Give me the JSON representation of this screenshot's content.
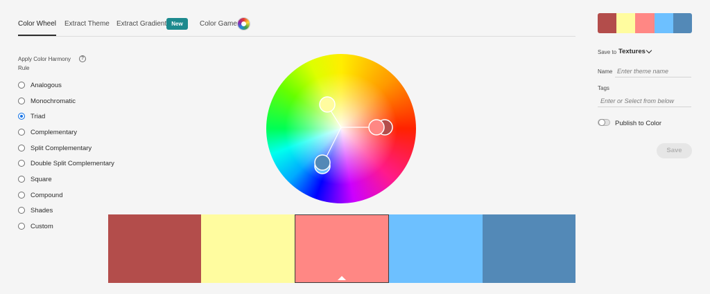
{
  "tabs": {
    "color_wheel": "Color Wheel",
    "extract_theme": "Extract Theme",
    "extract_gradient": "Extract Gradient",
    "new_badge": "New",
    "color_game": "Color Game"
  },
  "harmony": {
    "title": "Apply Color Harmony Rule",
    "selected": "Triad",
    "rules": [
      "Analogous",
      "Monochromatic",
      "Triad",
      "Complementary",
      "Split Complementary",
      "Double Split Complementary",
      "Square",
      "Compound",
      "Shades",
      "Custom"
    ]
  },
  "theme": {
    "colors": [
      "#B34D4B",
      "#FFFC9F",
      "#FF8784",
      "#6DC0FF",
      "#5389B7"
    ],
    "selected_index": 2
  },
  "panel": {
    "save_to_label": "Save to",
    "save_to_value": "Textures",
    "name_label": "Name",
    "name_placeholder": "Enter theme name",
    "tags_label": "Tags",
    "tags_placeholder": "Enter or Select from below",
    "publish_label": "Publish to Color",
    "publish_enabled": false,
    "save_label": "Save"
  },
  "icons": {
    "info": "info-icon",
    "chevron": "chevron-down-icon",
    "color_game": "color-game-icon"
  }
}
